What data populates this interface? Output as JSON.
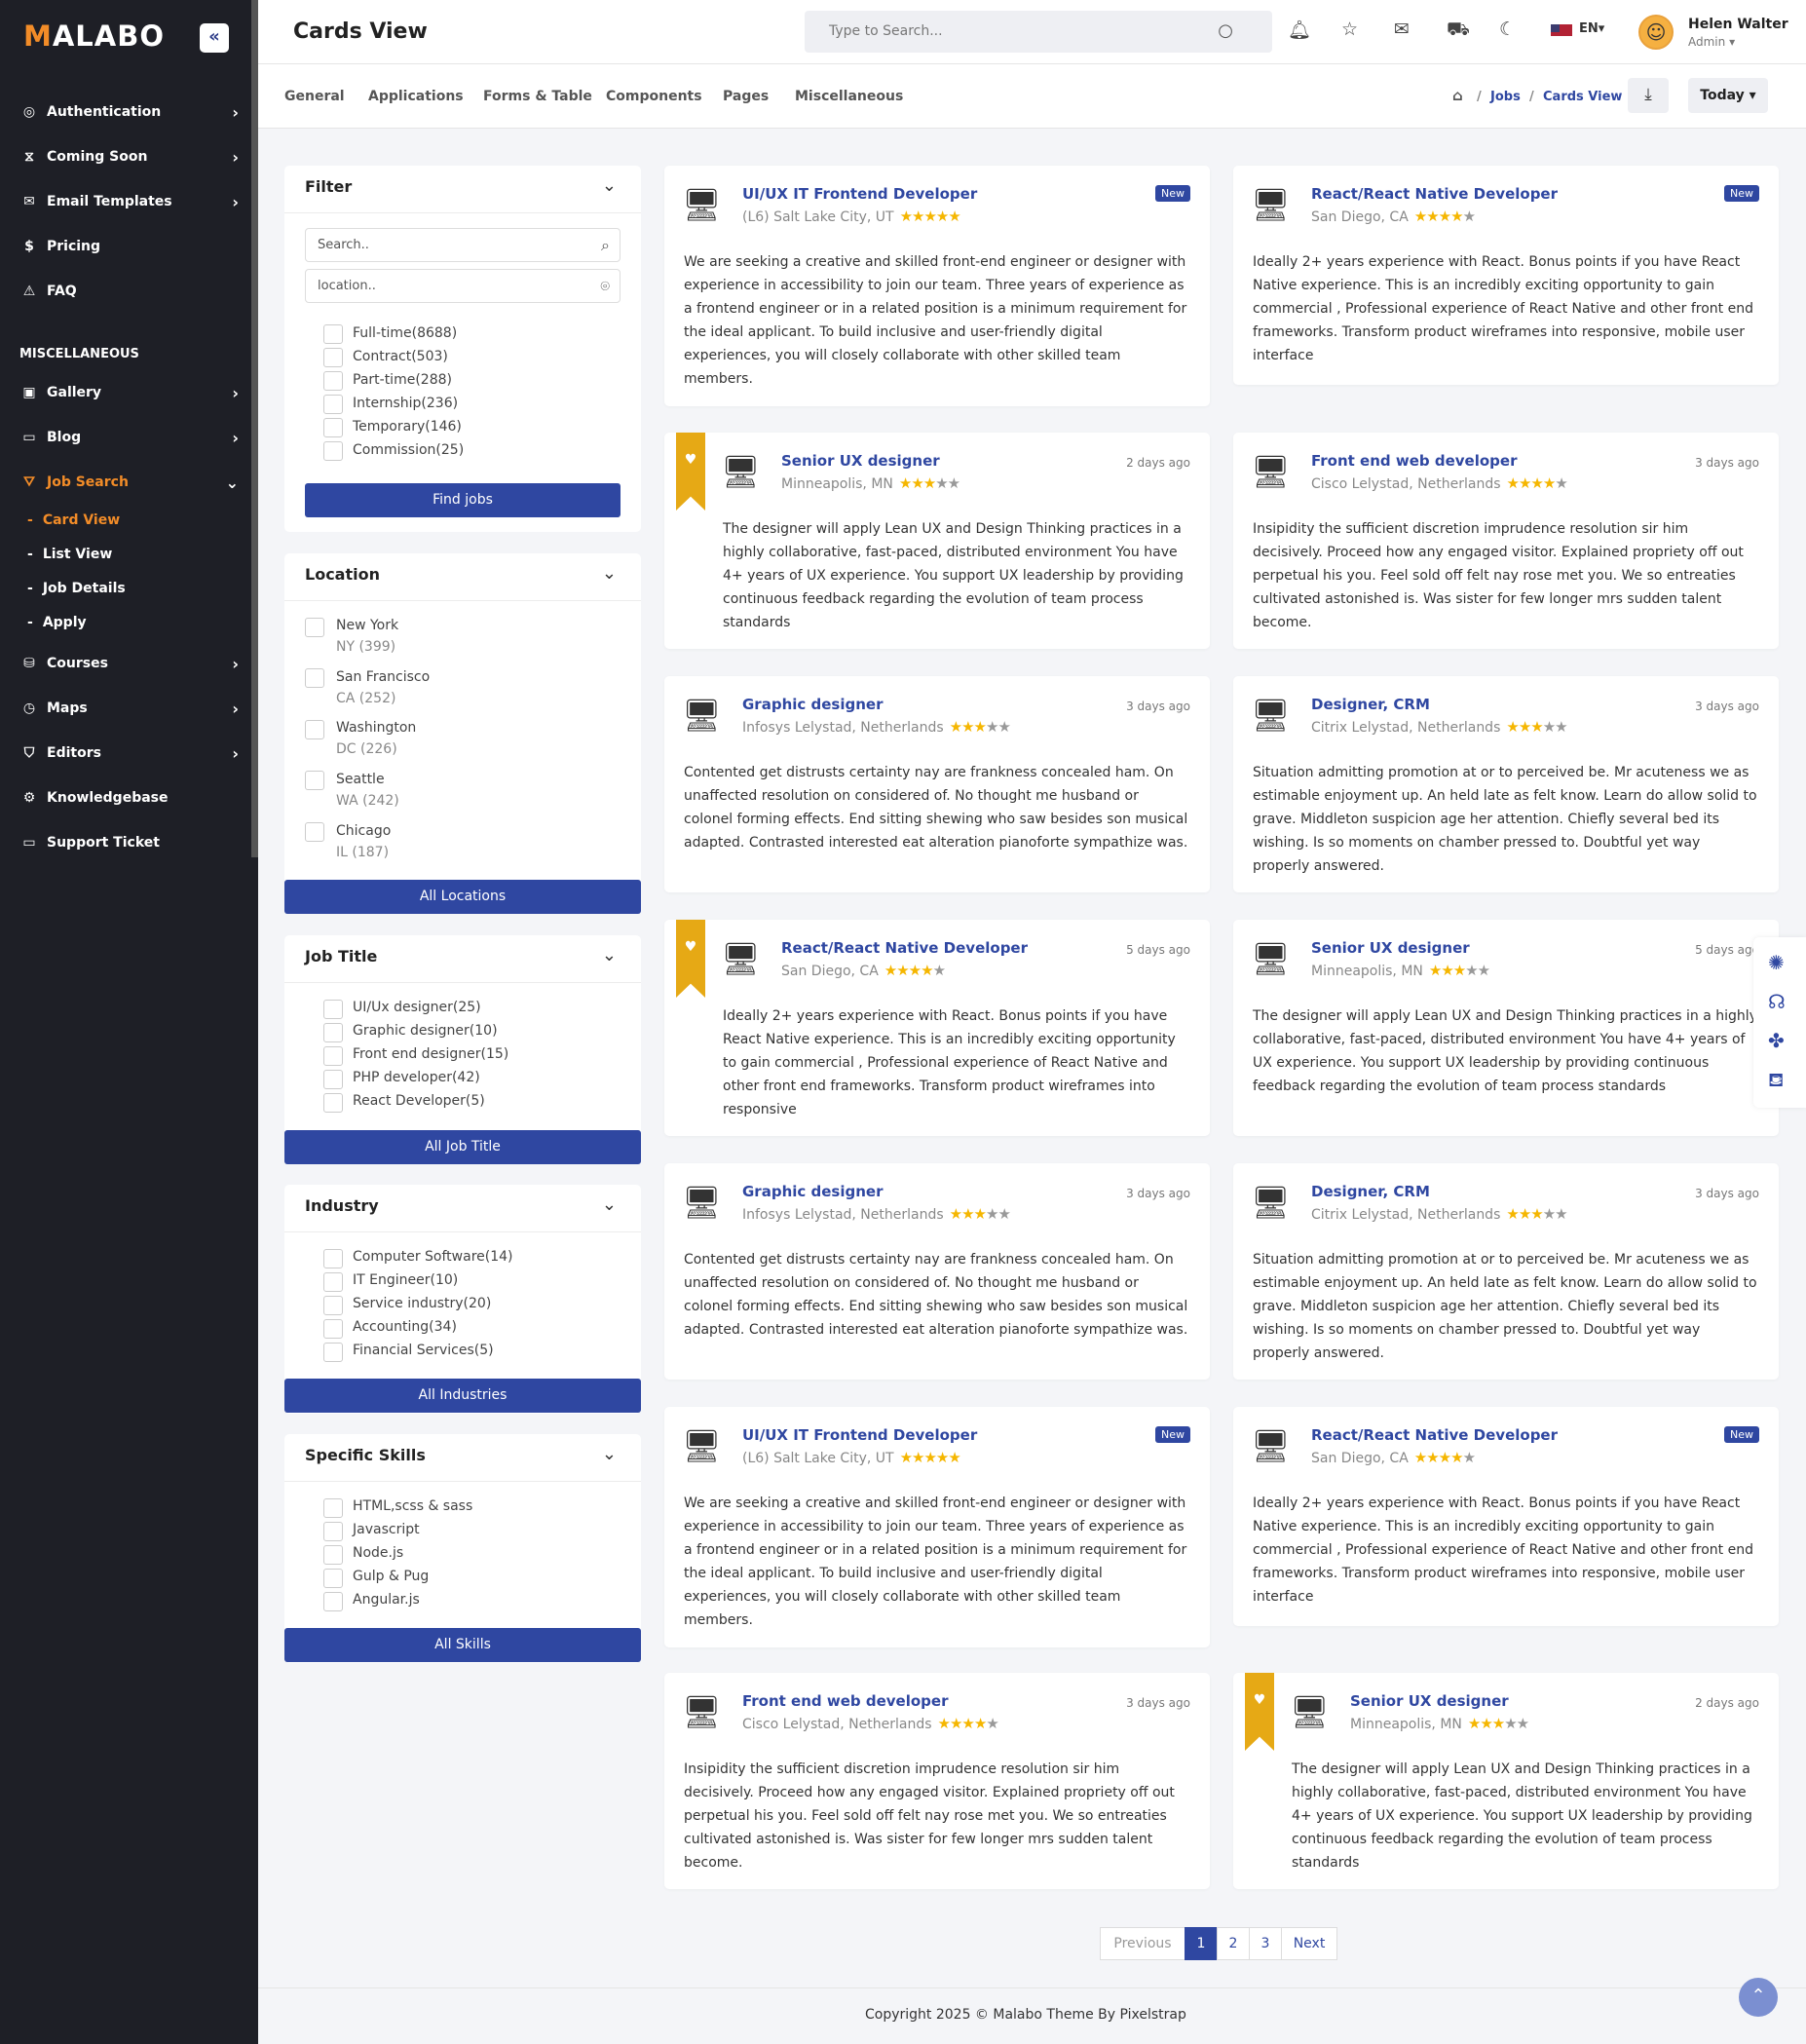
{
  "app": {
    "logo": "MALABO",
    "logo_first": "M",
    "logo_rest": "ALABO",
    "collapse_icon": "«",
    "page_title": "Cards View",
    "search_placeholder": "Type to Search...",
    "lang": "EN",
    "user": {
      "name": "Helen Walter",
      "role": "Admin"
    }
  },
  "sidebar": {
    "items": [
      {
        "label": "Authentication",
        "icon": "◎"
      },
      {
        "label": "Coming Soon",
        "icon": "⧖"
      },
      {
        "label": "Email Templates",
        "icon": "✉"
      },
      {
        "label": "Pricing",
        "icon": "$"
      },
      {
        "label": "FAQ",
        "icon": "⚠"
      }
    ],
    "section": "MISCELLANEOUS",
    "misc": [
      {
        "label": "Gallery",
        "icon": "▣"
      },
      {
        "label": "Blog",
        "icon": "▭"
      },
      {
        "label": "Job Search",
        "icon": "⛛"
      },
      {
        "label": "Courses",
        "icon": "⛁"
      },
      {
        "label": "Maps",
        "icon": "◷"
      },
      {
        "label": "Editors",
        "icon": "⛉"
      },
      {
        "label": "Knowledgebase",
        "icon": "⚙"
      },
      {
        "label": "Support Ticket",
        "icon": "▭"
      }
    ],
    "job_sub": [
      "Card View",
      "List View",
      "Job Details",
      "Apply"
    ]
  },
  "subnav": [
    "General",
    "Applications",
    "Forms & Table",
    "Components",
    "Pages",
    "Miscellaneous"
  ],
  "breadcrumb": {
    "home_icon": "⌂",
    "jobs": "Jobs",
    "current": "Cards View",
    "sep": "/"
  },
  "today": "Today",
  "filter": {
    "title": "Filter",
    "search_placeholder": "Search..",
    "location_placeholder": "location..",
    "types": [
      "Full-time(8688)",
      "Contract(503)",
      "Part-time(288)",
      "Internship(236)",
      "Temporary(146)",
      "Commission(25)"
    ],
    "button": "Find jobs"
  },
  "location": {
    "title": "Location",
    "items": [
      {
        "city": "New York",
        "sub": "NY (399)"
      },
      {
        "city": "San Francisco",
        "sub": "CA (252)"
      },
      {
        "city": "Washington",
        "sub": "DC (226)"
      },
      {
        "city": "Seattle",
        "sub": "WA (242)"
      },
      {
        "city": "Chicago",
        "sub": "IL (187)"
      }
    ],
    "button": "All Locations"
  },
  "job_title": {
    "title": "Job Title",
    "items": [
      "UI/Ux designer(25)",
      "Graphic designer(10)",
      "Front end designer(15)",
      "PHP developer(42)",
      "React Developer(5)"
    ],
    "button": "All Job Title"
  },
  "industry": {
    "title": "Industry",
    "items": [
      "Computer Software(14)",
      "IT Engineer(10)",
      "Service industry(20)",
      "Accounting(34)",
      "Financial Services(5)"
    ],
    "button": "All Industries"
  },
  "skills": {
    "title": "Specific Skills",
    "items": [
      "HTML,scss & sass",
      "Javascript",
      "Node.js",
      "Gulp & Pug",
      "Angular.js"
    ],
    "button": "All Skills"
  },
  "cards": [
    {
      "title": "UI/UX IT Frontend Developer",
      "loc": "(L6) Salt Lake City, UT",
      "rating": 5,
      "badge": "New",
      "icon": "🖥",
      "desc": "We are seeking a creative and skilled front-end engineer or designer with experience in accessibility to join our team. Three years of experience as a frontend engineer or in a related position is a minimum requirement for the ideal applicant. To build inclusive and user-friendly digital experiences, you will closely collaborate with other skilled team members."
    },
    {
      "title": "React/React Native Developer",
      "loc": "San Diego, CA",
      "rating": 4,
      "badge": "New",
      "icon": "🖥",
      "desc": "Ideally 2+ years experience with React. Bonus points if you have React Native experience. This is an incredibly exciting opportunity to gain commercial , Professional experience of React Native and other front end frameworks. Transform product wireframes into responsive, mobile user interface"
    },
    {
      "title": "Senior UX designer",
      "loc": "Minneapolis, MN",
      "rating": 3,
      "time": "2 days ago",
      "ribbon": true,
      "icon": "🖥",
      "desc": "The designer will apply Lean UX and Design Thinking practices in a highly collaborative, fast-paced, distributed environment You have 4+ years of UX experience. You support UX leadership by providing continuous feedback regarding the evolution of team process standards"
    },
    {
      "title": "Front end web developer",
      "loc": "Cisco Lelystad, Netherlands",
      "rating": 4,
      "time": "3 days ago",
      "icon": "🖥",
      "desc": "Insipidity the sufficient discretion imprudence resolution sir him decisively. Proceed how any engaged visitor. Explained propriety off out perpetual his you. Feel sold off felt nay rose met you. We so entreaties cultivated astonished is. Was sister for few longer mrs sudden talent become."
    },
    {
      "title": "Graphic designer",
      "loc": "Infosys Lelystad, Netherlands",
      "rating": 3,
      "time": "3 days ago",
      "icon": "🖥",
      "desc": "Contented get distrusts certainty nay are frankness concealed ham. On unaffected resolution on considered of. No thought me husband or colonel forming effects. End sitting shewing who saw besides son musical adapted. Contrasted interested eat alteration pianoforte sympathize was."
    },
    {
      "title": "Designer, CRM",
      "loc": "Citrix Lelystad, Netherlands",
      "rating": 3,
      "time": "3 days ago",
      "icon": "🖥",
      "desc": "Situation admitting promotion at or to perceived be. Mr acuteness we as estimable enjoyment up. An held late as felt know. Learn do allow solid to grave. Middleton suspicion age her attention. Chiefly several bed its wishing. Is so moments on chamber pressed to. Doubtful yet way properly answered."
    },
    {
      "title": "React/React Native Developer",
      "loc": "San Diego, CA",
      "rating": 4,
      "time": "5 days ago",
      "ribbon": true,
      "icon": "🖥",
      "desc": "Ideally 2+ years experience with React. Bonus points if you have React Native experience. This is an incredibly exciting opportunity to gain commercial , Professional experience of React Native and other front end frameworks. Transform product wireframes into responsive"
    },
    {
      "title": "Senior UX designer",
      "loc": "Minneapolis, MN",
      "rating": 3,
      "time": "5 days ago",
      "icon": "🖥",
      "desc": "The designer will apply Lean UX and Design Thinking practices in a highly collaborative, fast-paced, distributed environment You have 4+ years of UX experience. You support UX leadership by providing continuous feedback regarding the evolution of team process standards"
    },
    {
      "title": "Graphic designer",
      "loc": "Infosys Lelystad, Netherlands",
      "rating": 3,
      "time": "3 days ago",
      "icon": "🖥",
      "desc": "Contented get distrusts certainty nay are frankness concealed ham. On unaffected resolution on considered of. No thought me husband or colonel forming effects. End sitting shewing who saw besides son musical adapted. Contrasted interested eat alteration pianoforte sympathize was."
    },
    {
      "title": "Designer, CRM",
      "loc": "Citrix Lelystad, Netherlands",
      "rating": 3,
      "time": "3 days ago",
      "icon": "🖥",
      "desc": "Situation admitting promotion at or to perceived be. Mr acuteness we as estimable enjoyment up. An held late as felt know. Learn do allow solid to grave. Middleton suspicion age her attention. Chiefly several bed its wishing. Is so moments on chamber pressed to. Doubtful yet way properly answered."
    },
    {
      "title": "UI/UX IT Frontend Developer",
      "loc": "(L6) Salt Lake City, UT",
      "rating": 5,
      "badge": "New",
      "icon": "🖥",
      "desc": "We are seeking a creative and skilled front-end engineer or designer with experience in accessibility to join our team. Three years of experience as a frontend engineer or in a related position is a minimum requirement for the ideal applicant. To build inclusive and user-friendly digital experiences, you will closely collaborate with other skilled team members."
    },
    {
      "title": "React/React Native Developer",
      "loc": "San Diego, CA",
      "rating": 4,
      "badge": "New",
      "icon": "🖥",
      "desc": "Ideally 2+ years experience with React. Bonus points if you have React Native experience. This is an incredibly exciting opportunity to gain commercial , Professional experience of React Native and other front end frameworks. Transform product wireframes into responsive, mobile user interface"
    },
    {
      "title": "Front end web developer",
      "loc": "Cisco Lelystad, Netherlands",
      "rating": 4,
      "time": "3 days ago",
      "icon": "🖥",
      "desc": "Insipidity the sufficient discretion imprudence resolution sir him decisively. Proceed how any engaged visitor. Explained propriety off out perpetual his you. Feel sold off felt nay rose met you. We so entreaties cultivated astonished is. Was sister for few longer mrs sudden talent become."
    },
    {
      "title": "Senior UX designer",
      "loc": "Minneapolis, MN",
      "rating": 3,
      "time": "2 days ago",
      "ribbon": true,
      "icon": "🖥",
      "desc": "The designer will apply Lean UX and Design Thinking practices in a highly collaborative, fast-paced, distributed environment You have 4+ years of UX experience. You support UX leadership by providing continuous feedback regarding the evolution of team process standards"
    }
  ],
  "pagination": {
    "prev": "Previous",
    "pages": [
      "1",
      "2",
      "3"
    ],
    "next": "Next",
    "current": "1"
  },
  "footer": "Copyright 2025 © Malabo Theme By Pixelstrap",
  "colors": {
    "primary": "#2f47a1",
    "accent": "#f28c28",
    "star": "#f5b600",
    "ribbon": "#e6a915",
    "sidebar": "#1e1f26"
  }
}
